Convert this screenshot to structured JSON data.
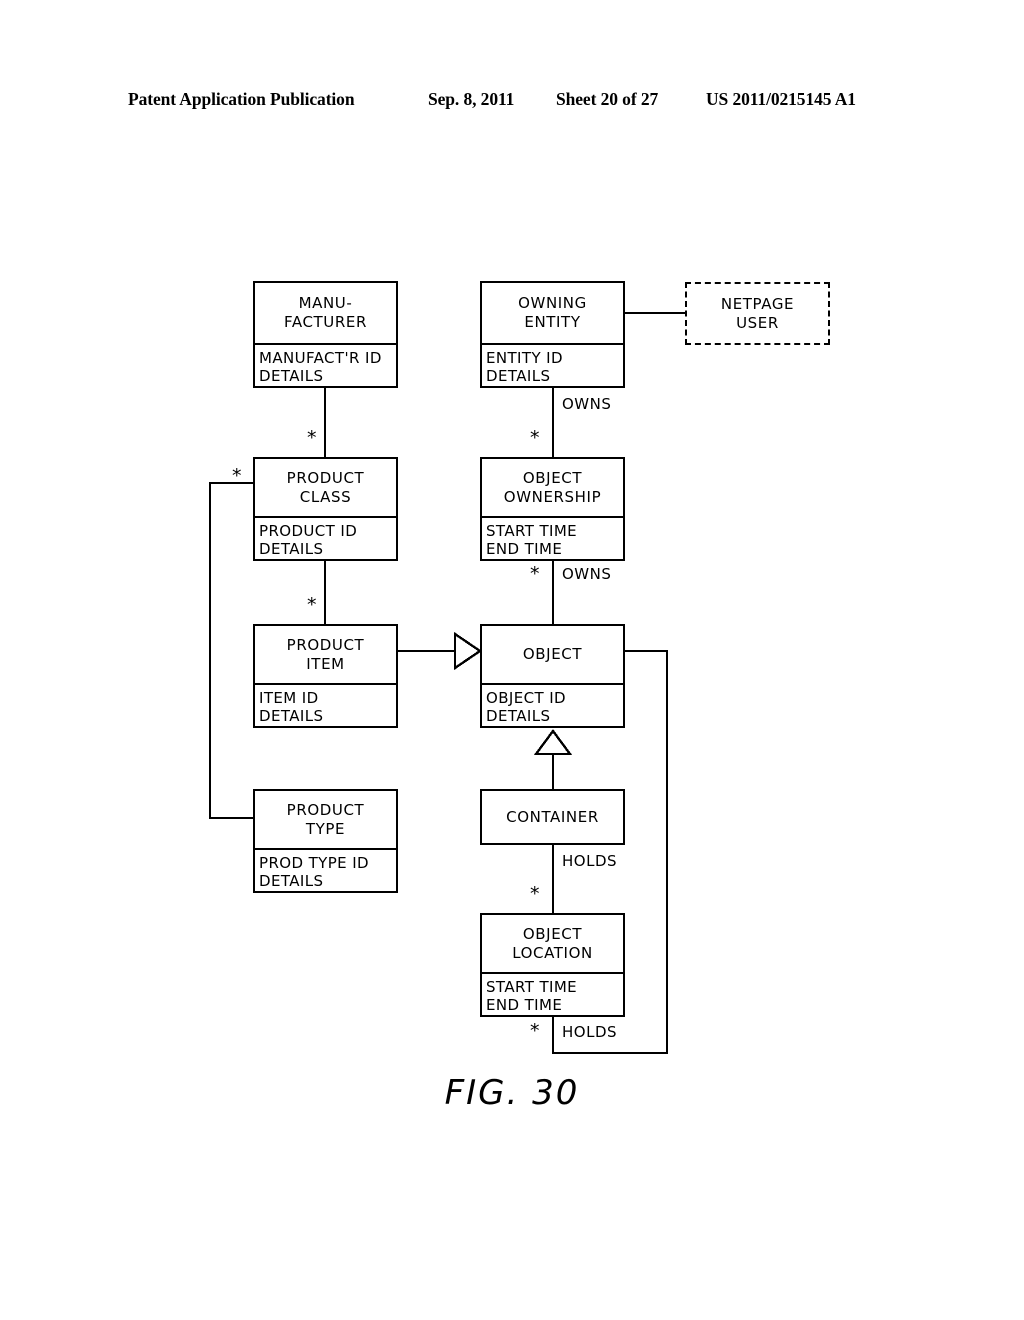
{
  "header": {
    "publication": "Patent Application Publication",
    "date": "Sep. 8, 2011",
    "sheet": "Sheet 20 of 27",
    "patent_number": "US 2011/0215145 A1"
  },
  "figure": {
    "caption": "FIG. 30"
  },
  "diagram": {
    "type": "uml-class-diagram",
    "entities": [
      {
        "id": "manufacturer",
        "title": "MANU-\nFACTURER",
        "attributes": "MANUFACT'R ID\nDETAILS",
        "style": "solid"
      },
      {
        "id": "owning-entity",
        "title": "OWNING\nENTITY",
        "attributes": "ENTITY ID\nDETAILS",
        "style": "solid"
      },
      {
        "id": "netpage-user",
        "title": "NETPAGE\nUSER",
        "attributes": "",
        "style": "dashed"
      },
      {
        "id": "product-class",
        "title": "PRODUCT\nCLASS",
        "attributes": "PRODUCT ID\nDETAILS",
        "style": "solid"
      },
      {
        "id": "object-ownership",
        "title": "OBJECT\nOWNERSHIP",
        "attributes": "START TIME\nEND TIME",
        "style": "solid"
      },
      {
        "id": "product-item",
        "title": "PRODUCT\nITEM",
        "attributes": "ITEM ID\nDETAILS",
        "style": "solid"
      },
      {
        "id": "object",
        "title": "OBJECT",
        "attributes": "OBJECT ID\nDETAILS",
        "style": "solid"
      },
      {
        "id": "product-type",
        "title": "PRODUCT\nTYPE",
        "attributes": "PROD TYPE ID\nDETAILS",
        "style": "solid"
      },
      {
        "id": "container",
        "title": "CONTAINER",
        "attributes": "",
        "style": "solid"
      },
      {
        "id": "object-location",
        "title": "OBJECT\nLOCATION",
        "attributes": "START TIME\nEND TIME",
        "style": "solid"
      }
    ],
    "edge_labels": {
      "owns_entity_ownership": "OWNS",
      "owns_ownership_object": "OWNS",
      "holds_container_location": "HOLDS",
      "holds_location_object": "HOLDS"
    },
    "multiplicities": {
      "manufacturer_product_class": "*",
      "product_class_product_type": "*",
      "product_class_product_item": "*",
      "owning_entity_ownership": "*",
      "ownership_object": "*",
      "container_object_location": "*",
      "object_location_object": "*"
    }
  }
}
